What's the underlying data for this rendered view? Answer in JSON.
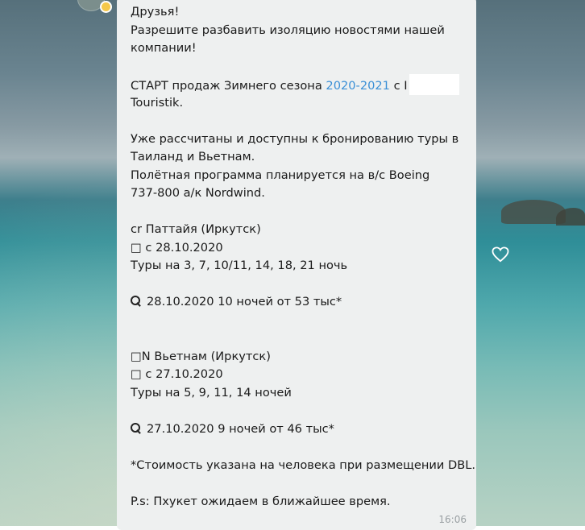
{
  "message": {
    "lines": [
      "Друзья!",
      "Разрешите разбавить изоляцию новостями нашей",
      "компании!",
      "",
      {
        "before": "СТАРТ продаж Зимнего сезона ",
        "link": "2020-2021",
        "after": " с I"
      },
      "Touristik.",
      "",
      "Уже рассчитаны и доступны к бронированию туры в",
      "Таиланд и Вьетнам.",
      "Полётная программа планируется на в/с Boeing",
      "737-800 а/к Nordwind.",
      "",
      "cr Паттайя (Иркутск)",
      "□ с 28.10.2020",
      "Туры на 3, 7, 10/11, 14, 18, 21 ночь",
      "",
      {
        "icon": "search-icon",
        "text": "28.10.2020 10 ночей от 53 тыс*"
      },
      "",
      "",
      "□N Вьетнам (Иркутск)",
      "□ с 27.10.2020",
      "Туры на 5, 9, 11, 14 ночей",
      "",
      {
        "icon": "search-icon",
        "text": "27.10.2020 9 ночей от 46 тыс*"
      },
      "",
      "*Стоимость указана на человека при размещении DBL.",
      "",
      "P.s: Пхукет ожидаем в ближайшее время."
    ],
    "time": "16:06"
  },
  "colors": {
    "bubble": "#eef0f0",
    "link": "#3a8fd6",
    "text": "#1a1a1a",
    "time": "#9aa0a3"
  },
  "icons": {
    "like": "heart-outline-icon",
    "avatar_badge": "star-badge-icon"
  }
}
